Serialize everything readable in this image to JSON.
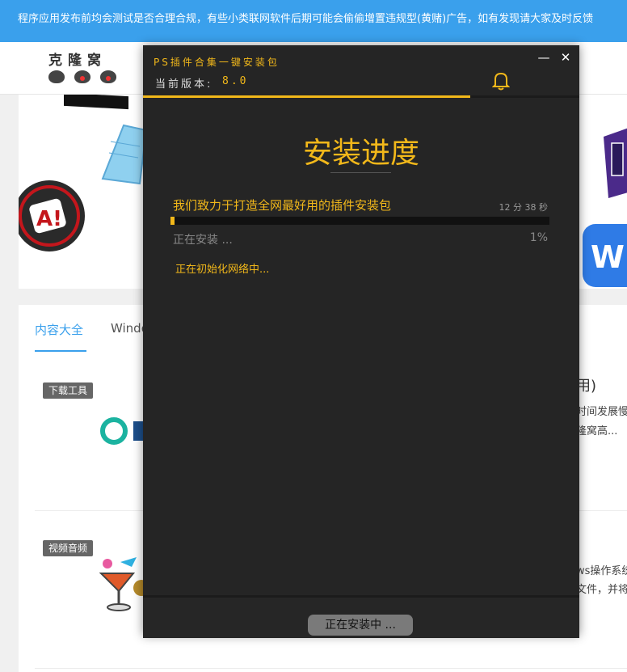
{
  "notice": "程序应用发布前均会测试是否合理合规，有些小类联网软件后期可能会偷偷增置违规型(黄赌)广告，如有发现请大家及时反馈",
  "site": {
    "logo_text": "克隆窝"
  },
  "tabs": [
    {
      "label": "内容大全"
    },
    {
      "label": "Windo"
    }
  ],
  "categories": [
    {
      "tag": "下载工具"
    },
    {
      "tag": "视频音频"
    }
  ],
  "peek_text": {
    "a1": "用)",
    "a2": "时间发展慢",
    "a3": "隆窝高...",
    "b1": "ws操作系统",
    "b2": "文件，并将"
  },
  "installer": {
    "title": "PS插件合集一键安装包",
    "version_label": "当前版本:",
    "version": "8.0",
    "heading": "安装进度",
    "slogan": "我们致力于打造全网最好用的插件安装包",
    "time_remaining": "12 分 38 秒",
    "status": "正在安装 ...",
    "percent_text": "1%",
    "progress": 0.01,
    "network_status": "正在初始化网络中...",
    "footer_button": "正在安装中 ...",
    "minimize_glyph": "—",
    "close_glyph": "✕",
    "accent": "#f2b81a"
  }
}
